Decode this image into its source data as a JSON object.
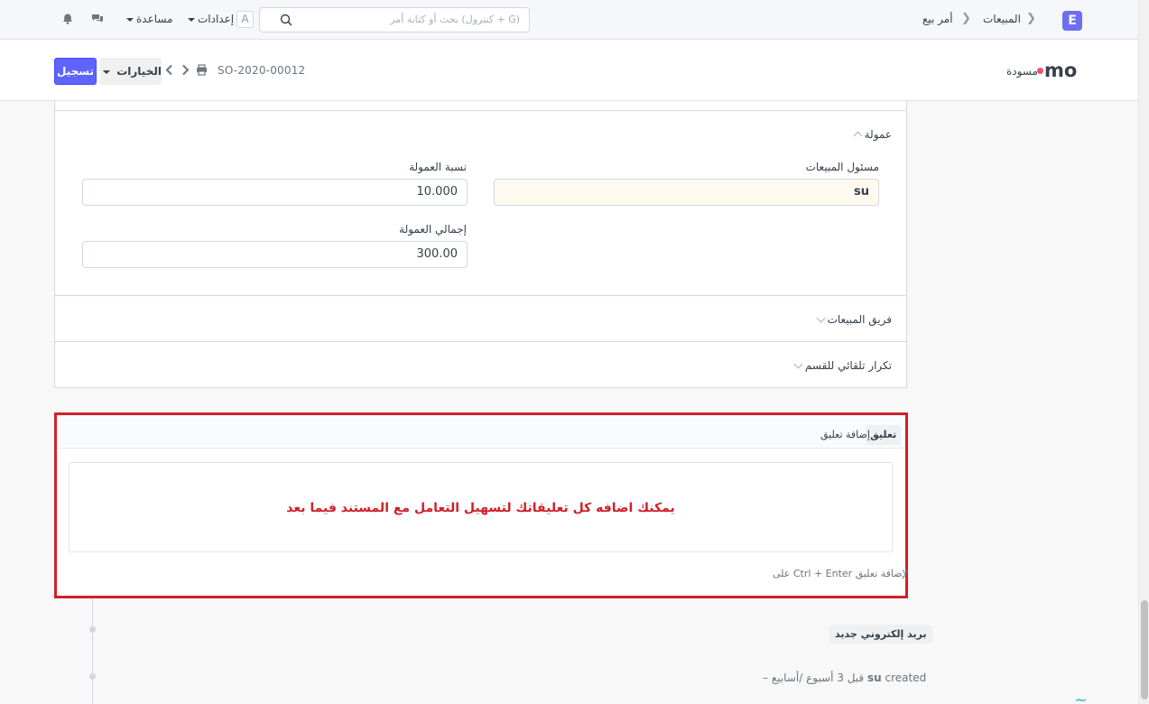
{
  "navbar": {
    "logo_letter": "E",
    "breadcrumbs": [
      "المبيعات",
      "أمر بيع"
    ],
    "search_placeholder": "بحث أو كتابة أمر (كنترول + G)",
    "avatar_letter": "A",
    "settings_label": "إعدادات",
    "help_label": "مساعدة"
  },
  "page_head": {
    "title": "mo",
    "status": "مسودة",
    "doc_name": "SO-2020-00012",
    "options_label": "الخيارات",
    "save_label": "تسجيل"
  },
  "form": {
    "commission_section": "عمولة",
    "sales_partner_label": "مسئول المبيعات",
    "sales_partner_value": "su",
    "commission_rate_label": "نسبة العمولة",
    "commission_rate_value": "10.000",
    "total_commission_label": "إجمالي العمولة",
    "total_commission_value": "300.00",
    "sales_team_section": "فريق المبيعات",
    "auto_repeat_section": "تكرار تلقائي للقسم"
  },
  "comments": {
    "tab_label": "تعليق",
    "add_comment_label": "إضافة تعليق",
    "note": "يمكنك اضافه كل تعليقاتك لتسهيل التعامل مع المستند فيما بعد",
    "hint": "على Ctrl + Enter لإضافة تعليق"
  },
  "timeline": {
    "new_email_label": "بريد إلكتروني جديد",
    "activity_user": "su",
    "activity_text": "created",
    "activity_time": "– قبل 3 أسبوع /أسابيع"
  },
  "colors": {
    "primary": "#5e64ff",
    "highlight": "#d0202a",
    "draft_indicator": "#f0526a"
  }
}
